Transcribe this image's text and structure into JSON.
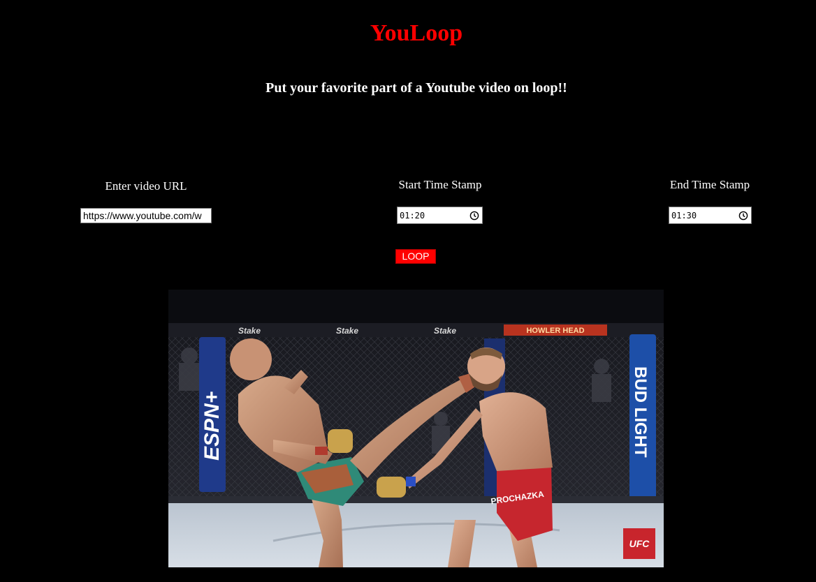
{
  "app": {
    "title": "YouLoop",
    "subtitle": "Put your favorite part of a Youtube video on loop!!"
  },
  "form": {
    "url_label": "Enter video URL",
    "url_value": "https://www.youtube.com/w",
    "start_label": "Start Time Stamp",
    "start_value": "01:20",
    "end_label": "End Time Stamp",
    "end_value": "01:30",
    "loop_button": "LOOP"
  },
  "video": {
    "scene": "UFC fight frame with head kick inside octagon",
    "signage": {
      "espn": "ESPN+",
      "bud_light": "BUD LIGHT",
      "howler_head": "HOWLER HEAD",
      "stake": "Stake",
      "ufc_logo": "UFC",
      "shorts_name": "PROCHAZKA"
    }
  },
  "colors": {
    "background": "#000000",
    "accent": "#ff0000",
    "text": "#ffffff"
  }
}
